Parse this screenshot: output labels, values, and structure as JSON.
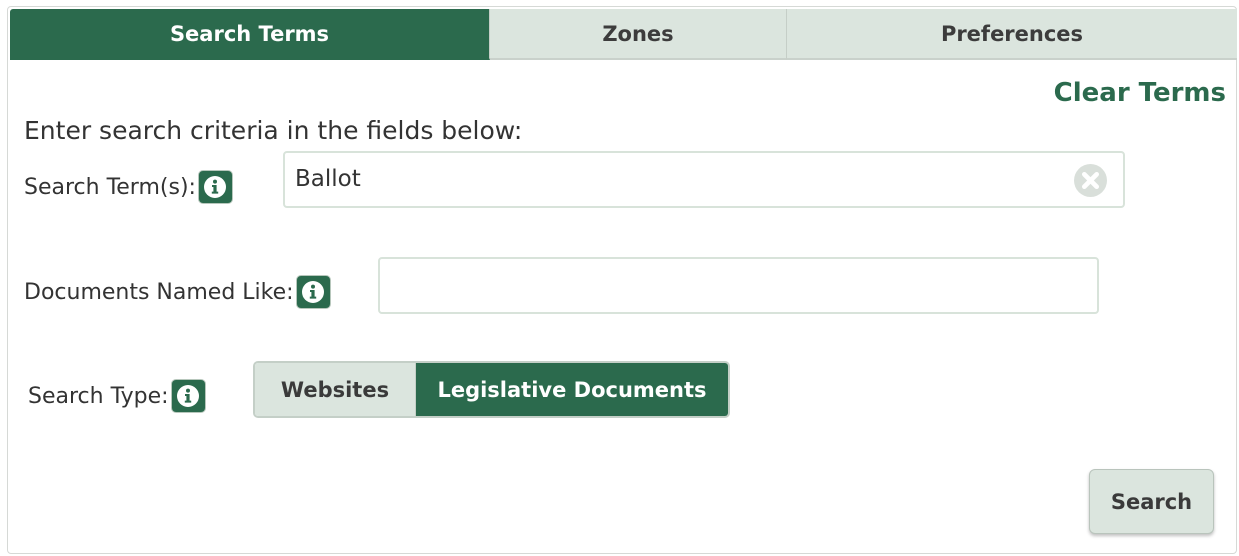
{
  "tabs": [
    {
      "label": "Search Terms",
      "active": true
    },
    {
      "label": "Zones",
      "active": false
    },
    {
      "label": "Preferences",
      "active": false
    }
  ],
  "clear_terms": "Clear Terms",
  "instruction": "Enter search criteria in the fields below:",
  "fields": {
    "search_terms": {
      "label": "Search Term(s):",
      "value": "Ballot",
      "info_icon": "info-icon",
      "clear_icon": "clear-icon"
    },
    "documents_named_like": {
      "label": "Documents Named Like:",
      "value": "",
      "info_icon": "info-icon"
    },
    "search_type": {
      "label": "Search Type:",
      "info_icon": "info-icon",
      "options": [
        "Websites",
        "Legislative Documents"
      ],
      "selected": "Legislative Documents"
    }
  },
  "search_button": "Search",
  "colors": {
    "accent": "#2b6a4d",
    "inactive_bg": "#dbe5de",
    "border": "#d8e3da"
  }
}
